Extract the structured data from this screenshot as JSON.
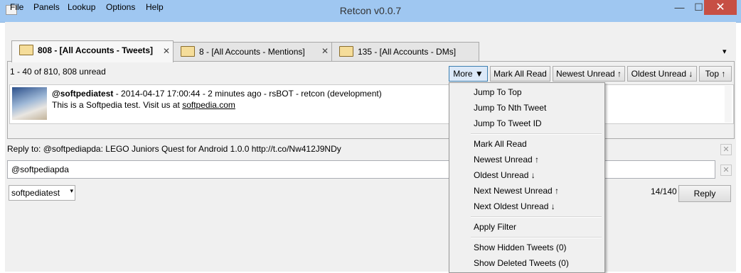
{
  "window": {
    "title": "Retcon v0.0.7",
    "min": "—",
    "max": "☐",
    "close": "✕"
  },
  "menu": {
    "items": [
      "File",
      "Panels",
      "Lookup",
      "Options",
      "Help"
    ]
  },
  "tabs": [
    {
      "label": "808 - [All Accounts - Tweets]",
      "close": "✕"
    },
    {
      "label": "8 - [All Accounts - Mentions]",
      "close": "✕"
    },
    {
      "label": "135 - [All Accounts - DMs]"
    }
  ],
  "tab_overflow": "▾",
  "status": "1 - 40 of 810, 808 unread",
  "toolbar": {
    "more": "More ▼",
    "mark_all_read": "Mark All Read",
    "newest_unread": "Newest Unread ↑",
    "oldest_unread": "Oldest Unread ↓",
    "top": "Top ↑"
  },
  "tweet": {
    "user": "@softpediatest",
    "meta": " - 2014-04-17 17:00:44 - 2 minutes ago - rsBOT - retcon (development)",
    "text": "This is a Softpedia test. Visit us at ",
    "link": "softpedia.com"
  },
  "reply": {
    "reply_to": "Reply to: @softpediapda: LEGO Juniors Quest for Android 1.0.0 http://t.co/Nw412J9NDy",
    "input_value": "@softpediapda",
    "account": "softpediatest",
    "char_count": "14/140",
    "reply_button": "Reply"
  },
  "dropdown": {
    "groups": [
      [
        "Jump To Top",
        "Jump To Nth Tweet",
        "Jump To Tweet ID"
      ],
      [
        "Mark All Read",
        "Newest Unread ↑",
        "Oldest Unread ↓",
        "Next Newest Unread ↑",
        "Next Oldest Unread ↓"
      ],
      [
        "Apply Filter"
      ],
      [
        "Show Hidden Tweets (0)",
        "Show Deleted Tweets (0)"
      ]
    ]
  }
}
